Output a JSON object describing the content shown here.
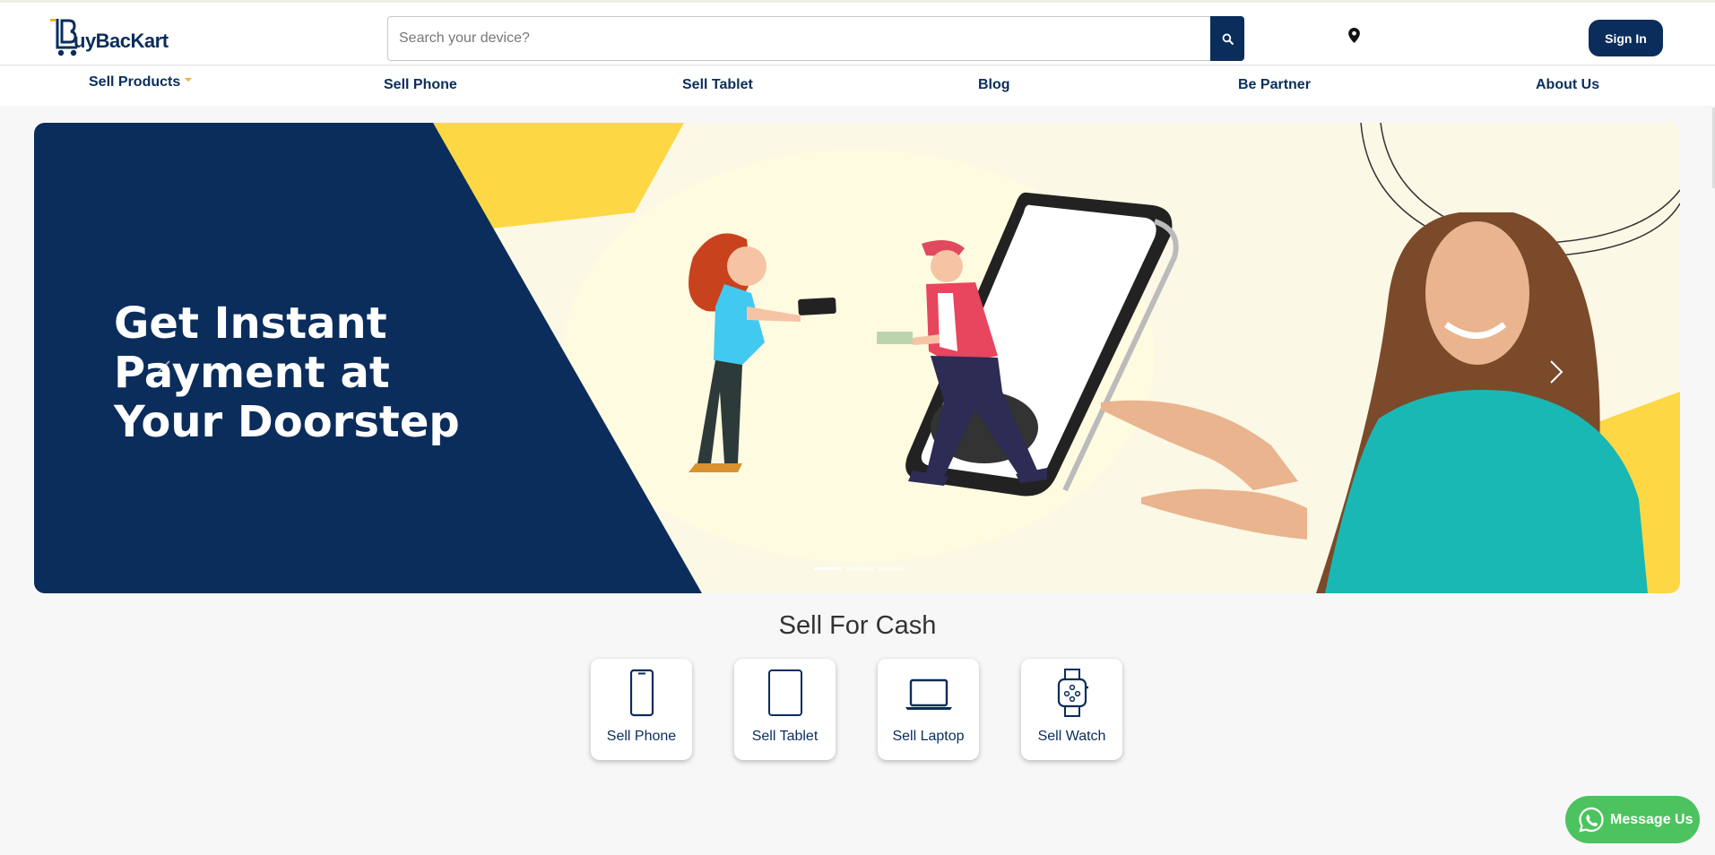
{
  "header": {
    "logo_text": "uyBacKart",
    "search_placeholder": "Search your device?",
    "search_icon": "search-icon",
    "location_icon": "map-pin-icon",
    "signin_label": "Sign In"
  },
  "nav": {
    "items": [
      {
        "label": "Sell Products"
      },
      {
        "label": "Sell Phone"
      },
      {
        "label": "Sell Tablet"
      },
      {
        "label": "Blog"
      },
      {
        "label": "Be Partner"
      },
      {
        "label": "About Us"
      }
    ]
  },
  "banner": {
    "headline": [
      "Get Instant",
      "Payment at",
      "Your Doorstep"
    ],
    "prev_icon": "chevron-left-icon",
    "next_icon": "chevron-right-icon",
    "slides": 3,
    "active_slide": 1
  },
  "sell": {
    "title": "Sell For Cash",
    "cards": [
      {
        "label": "Sell Phone",
        "icon": "phone-icon"
      },
      {
        "label": "Sell Tablet",
        "icon": "tablet-icon"
      },
      {
        "label": "Sell Laptop",
        "icon": "laptop-icon"
      },
      {
        "label": "Sell Watch",
        "icon": "watch-icon"
      }
    ]
  },
  "whatsapp": {
    "label": "Message Us",
    "icon": "whatsapp-icon"
  },
  "colors": {
    "brand": "#0a2d5c",
    "accent": "#f2b233",
    "banner_yellow": "#fdd744",
    "whatsapp": "#4cc35f"
  }
}
